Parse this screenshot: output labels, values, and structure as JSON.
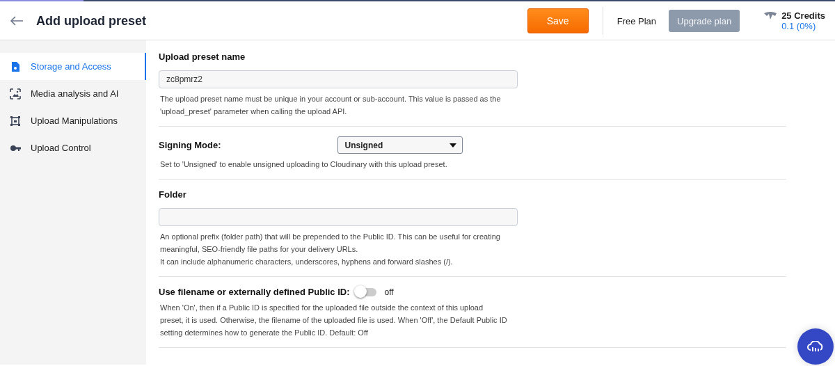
{
  "header": {
    "title": "Add upload preset",
    "save": "Save",
    "plan": "Free Plan",
    "upgrade": "Upgrade plan",
    "credits": "25 Credits",
    "usage": "0.1 (0%)"
  },
  "sidebar": {
    "items": [
      {
        "label": "Storage and Access",
        "kind": "file",
        "selected": true
      },
      {
        "label": "Media analysis and AI",
        "kind": "image",
        "selected": false
      },
      {
        "label": "Upload Manipulations",
        "kind": "crop",
        "selected": false
      },
      {
        "label": "Upload Control",
        "kind": "key",
        "selected": false
      }
    ]
  },
  "sections": [
    {
      "kind": "text",
      "label": "Upload preset name",
      "value": "zc8pmrz2",
      "help": [
        "The upload preset name must be unique in your account or sub-account. This value is passed as the 'upload_preset' parameter when calling the upload API."
      ]
    },
    {
      "kind": "select",
      "label": "Signing Mode:",
      "value": "Unsigned",
      "help": [
        "Set to 'Unsigned' to enable unsigned uploading to Cloudinary with this upload preset."
      ]
    },
    {
      "kind": "text",
      "label": "Folder",
      "help": [
        "An optional prefix (folder path) that will be prepended to the Public ID. This can be useful for creating meaningful, SEO-friendly file paths for your delivery URLs.",
        "It can include alphanumeric characters, underscores, hyphens and forward slashes (/)."
      ]
    },
    {
      "kind": "toggle",
      "label": "Use filename or externally defined Public ID:",
      "on": false,
      "state_text": "off",
      "help": [
        "When 'On', then if a Public ID is specified for the uploaded file outside the context of this upload preset, it is used. Otherwise, the filename of the uploaded file is used. When 'Off', the Default Public ID setting determines how to generate the Public ID. Default: Off"
      ]
    }
  ]
}
